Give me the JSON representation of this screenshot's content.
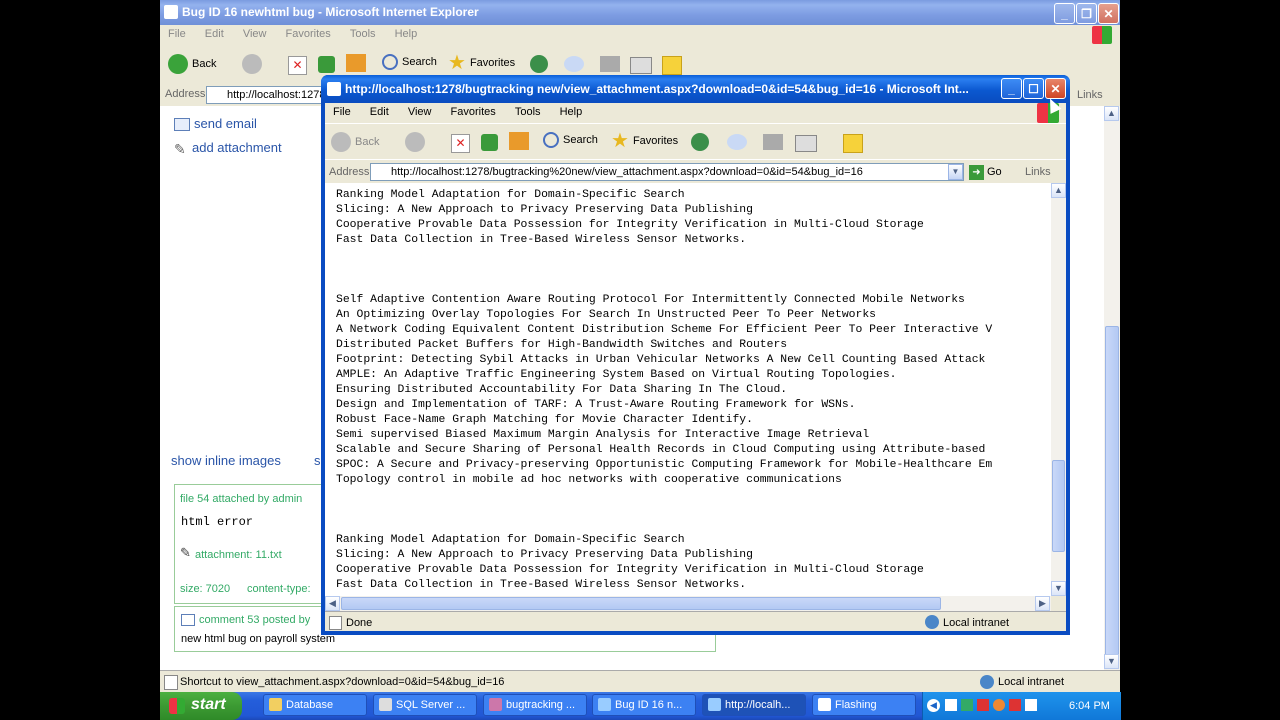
{
  "back_window": {
    "title": "Bug ID 16 newhtml bug - Microsoft Internet Explorer",
    "menu": [
      "File",
      "Edit",
      "View",
      "Favorites",
      "Tools",
      "Help"
    ],
    "toolbar": {
      "back": "Back",
      "search": "Search",
      "favorites": "Favorites"
    },
    "address_label": "Address",
    "address_value": "http://localhost:1278",
    "links": "Links",
    "sidebar": {
      "send_email": "send email",
      "add_attachment": "add attachment",
      "show_inline_images": "show inline images",
      "s_prefix": "s"
    },
    "attachment_box": {
      "header": "file 54 attached by admin",
      "line1": "html error",
      "attachment": "attachment: 11.txt",
      "size": "size: 7020",
      "content_type": "content-type:"
    },
    "comment_box": {
      "header": "comment 53 posted by",
      "text": "new html bug on payroll system"
    },
    "status": "Shortcut to view_attachment.aspx?download=0&id=54&bug_id=16",
    "zone": "Local intranet"
  },
  "popup_window": {
    "title": "http://localhost:1278/bugtracking new/view_attachment.aspx?download=0&id=54&bug_id=16 - Microsoft Int...",
    "menu": [
      "File",
      "Edit",
      "View",
      "Favorites",
      "Tools",
      "Help"
    ],
    "toolbar": {
      "back": "Back",
      "search": "Search",
      "favorites": "Favorites"
    },
    "address_label": "Address",
    "address_value": "http://localhost:1278/bugtracking%20new/view_attachment.aspx?download=0&id=54&bug_id=16",
    "go": "Go",
    "links": "Links",
    "content_lines": [
      "Ranking Model Adaptation for Domain-Specific Search",
      "Slicing: A New Approach to Privacy Preserving Data Publishing",
      "Cooperative Provable Data Possession for Integrity Verification in Multi-Cloud Storage",
      "Fast Data Collection in Tree-Based Wireless Sensor Networks.",
      "",
      "",
      "",
      "Self Adaptive Contention Aware Routing Protocol For Intermittently Connected Mobile Networks",
      "An Optimizing Overlay Topologies For Search In Unstructed Peer To Peer Networks",
      "A Network Coding Equivalent Content Distribution Scheme For Efficient Peer To Peer Interactive V",
      "Distributed Packet Buffers for High-Bandwidth Switches and Routers",
      "Footprint: Detecting Sybil Attacks in Urban Vehicular Networks A New Cell Counting Based Attack",
      "AMPLE: An Adaptive Traffic Engineering System Based on Virtual Routing Topologies.",
      "Ensuring Distributed Accountability For Data Sharing In The Cloud.",
      "Design and Implementation of TARF: A Trust-Aware Routing Framework for WSNs.",
      "Robust Face-Name Graph Matching for Movie Character Identify.",
      "Semi supervised Biased Maximum Margin Analysis for Interactive Image Retrieval",
      "Scalable and Secure Sharing of Personal Health Records in Cloud Computing using Attribute-based",
      "SPOC: A Secure and Privacy-preserving Opportunistic Computing Framework for Mobile-Healthcare Em",
      "Topology control in mobile ad hoc networks with cooperative communications",
      "",
      "",
      "",
      "Ranking Model Adaptation for Domain-Specific Search",
      "Slicing: A New Approach to Privacy Preserving Data Publishing",
      "Cooperative Provable Data Possession for Integrity Verification in Multi-Cloud Storage",
      "Fast Data Collection in Tree-Based Wireless Sensor Networks."
    ],
    "status": "Done",
    "zone": "Local intranet"
  },
  "taskbar": {
    "start": "start",
    "buttons": [
      "Database",
      "SQL Server ...",
      "bugtracking ...",
      "Bug ID 16 n...",
      "http://localh...",
      "Flashing"
    ],
    "clock": "6:04 PM"
  },
  "colors": {
    "xp_blue": "#0a5fd8",
    "taskbar": "#245edb",
    "start_green": "#3c9a33",
    "link": "#2a55a8"
  }
}
